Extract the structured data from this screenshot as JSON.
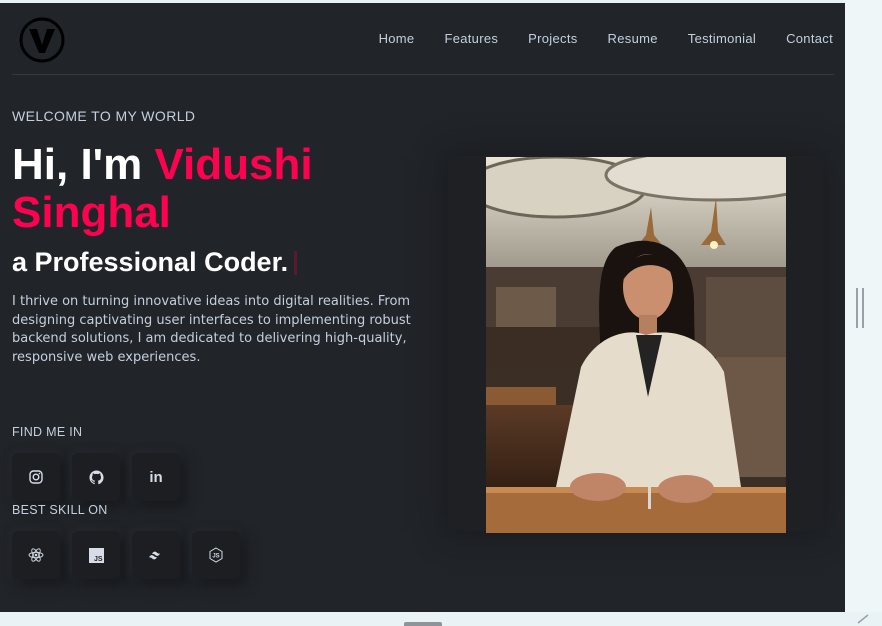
{
  "nav": {
    "logo_label": "V",
    "items": [
      "Home",
      "Features",
      "Projects",
      "Resume",
      "Testimonial",
      "Contact"
    ]
  },
  "hero": {
    "welcome": "WELCOME TO MY WORLD",
    "greeting": "Hi, I'm ",
    "name": "Vidushi Singhal",
    "tagline": "a Professional Coder.",
    "bio": "I thrive on turning innovative ideas into digital realities. From designing captivating user interfaces to implementing robust backend solutions, I am dedicated to delivering high-quality, responsive web experiences."
  },
  "social": {
    "label": "FIND ME IN",
    "items": [
      {
        "icon": "instagram-icon"
      },
      {
        "icon": "github-icon"
      },
      {
        "icon": "linkedin-icon",
        "text": "in"
      }
    ]
  },
  "skills": {
    "label": "BEST SKILL ON",
    "items": [
      {
        "icon": "react-icon"
      },
      {
        "icon": "javascript-icon",
        "text": "JS"
      },
      {
        "icon": "tailwind-icon"
      },
      {
        "icon": "nodejs-icon",
        "text": "JS"
      }
    ]
  },
  "colors": {
    "background": "#212428",
    "accent": "#ff014f",
    "text": "#c4cfde",
    "heading": "#ffffff"
  }
}
